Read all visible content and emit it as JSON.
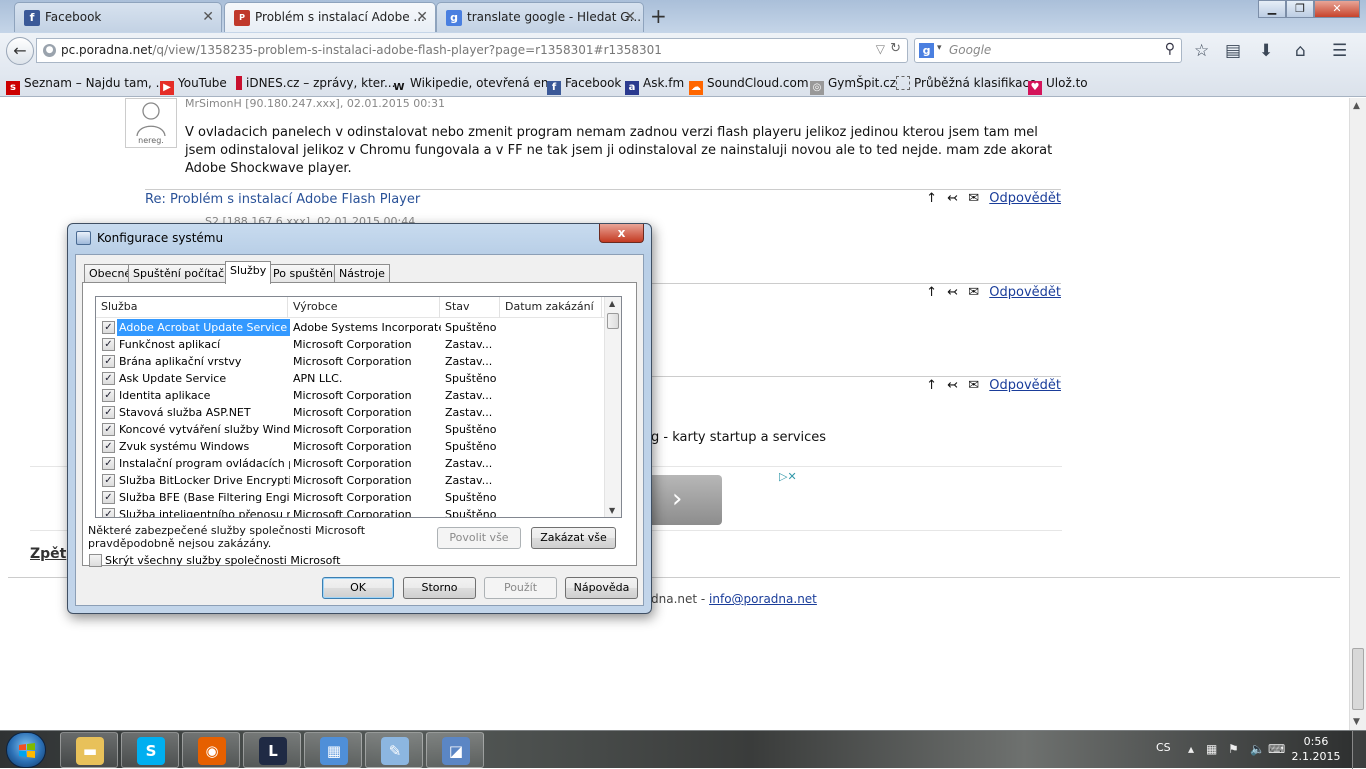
{
  "browser": {
    "tabs": [
      {
        "label": "Facebook",
        "icon": "facebook-icon",
        "active": false
      },
      {
        "label": "Problém s instalací Adobe ...",
        "icon": "poradna-icon",
        "active": true
      },
      {
        "label": "translate google - Hledat G...",
        "icon": "google-icon",
        "active": false
      }
    ],
    "new_tab": "+",
    "url_host": "pc.poradna.net",
    "url_path": "/q/view/1358235-problem-s-instalaci-adobe-flash-player?page=r1358301#r1358301",
    "search_placeholder": "Google",
    "bookmarks": [
      {
        "label": "Seznam – Najdu tam, ...",
        "icon": "seznam-icon",
        "color": "#cc0000"
      },
      {
        "label": "YouTube",
        "icon": "youtube-icon",
        "color": "#e52d27"
      },
      {
        "label": "iDNES.cz – zprávy, kter...",
        "icon": "idnes-icon",
        "color": "#c8102e"
      },
      {
        "label": "Wikipedie, otevřená en...",
        "icon": "wikipedia-icon",
        "color": "#444444"
      },
      {
        "label": "Facebook",
        "icon": "facebook-icon",
        "color": "#3b5998"
      },
      {
        "label": "Ask.fm",
        "icon": "askfm-icon",
        "color": "#2a3a8f"
      },
      {
        "label": "SoundCloud.com",
        "icon": "soundcloud-icon",
        "color": "#ff6600"
      },
      {
        "label": "GymŠpit.cz",
        "icon": "gymspit-icon",
        "color": "#999999"
      },
      {
        "label": "Průběžná klasifikace",
        "icon": "page-icon",
        "color": "#ffffff"
      },
      {
        "label": "Ulož.to",
        "icon": "ulozto-icon",
        "color": "#d4145a"
      }
    ]
  },
  "page": {
    "post1": {
      "avatar_label": "nereg.",
      "meta": "MrSimonH [90.180.247.xxx], 02.01.2015 00:31",
      "text": "V ovladacich panelech v odinstalovat nebo zmenit program nemam zadnou verzi flash playeru jelikoz jedinou kterou jsem tam mel jsem odinstaloval jelikoz v Chromu fungovala a v FF ne tak jsem ji odinstaloval ze nainstaluji novou ale to ted nejde. mam zde akorat Adobe Shockwave player."
    },
    "reply_title": "Re: Problém s instalací Adobe Flash Player",
    "reply_actions": {
      "up": "↑",
      "back": "↢",
      "mail": "✉",
      "reply": "Odpovědět"
    },
    "post2_meta": "S2 [188.167.6.xxx], 02.01.2015 00:44",
    "tail_text": "g - karty startup a services",
    "ad_next": "›",
    "ad_choices": "▷✕",
    "back_link": "Zpět",
    "footer_text": "dna.net - ",
    "footer_email": "info@poradna.net"
  },
  "dialog": {
    "title": "Konfigurace systému",
    "close": "x",
    "tabs": [
      "Obecné",
      "Spuštění počítače",
      "Služby",
      "Po spuštění",
      "Nástroje"
    ],
    "active_tab": "Služby",
    "columns": [
      "Služba",
      "Výrobce",
      "Stav",
      "Datum zakázání"
    ],
    "services": [
      {
        "name": "Adobe Acrobat Update Service",
        "vendor": "Adobe Systems Incorporated",
        "status": "Spuštěno",
        "checked": true
      },
      {
        "name": "Funkčnost aplikací",
        "vendor": "Microsoft Corporation",
        "status": "Zastav...",
        "checked": true
      },
      {
        "name": "Brána aplikační vrstvy",
        "vendor": "Microsoft Corporation",
        "status": "Zastav...",
        "checked": true
      },
      {
        "name": "Ask Update Service",
        "vendor": "APN LLC.",
        "status": "Spuštěno",
        "checked": true
      },
      {
        "name": "Identita aplikace",
        "vendor": "Microsoft Corporation",
        "status": "Zastav...",
        "checked": true
      },
      {
        "name": "Stavová služba ASP.NET",
        "vendor": "Microsoft Corporation",
        "status": "Zastav...",
        "checked": true
      },
      {
        "name": "Koncové vytváření služby Windo...",
        "vendor": "Microsoft Corporation",
        "status": "Spuštěno",
        "checked": true
      },
      {
        "name": "Zvuk systému Windows",
        "vendor": "Microsoft Corporation",
        "status": "Spuštěno",
        "checked": true
      },
      {
        "name": "Instalační program ovládacích pr...",
        "vendor": "Microsoft Corporation",
        "status": "Zastav...",
        "checked": true
      },
      {
        "name": "Služba BitLocker Drive Encryption",
        "vendor": "Microsoft Corporation",
        "status": "Zastav...",
        "checked": true
      },
      {
        "name": "Služba BFE (Base Filtering Engine)",
        "vendor": "Microsoft Corporation",
        "status": "Spuštěno",
        "checked": true
      },
      {
        "name": "Služba inteligentního přenosu na...",
        "vendor": "Microsoft Corporation",
        "status": "Spuštěno",
        "checked": true
      }
    ],
    "note": "Některé zabezpečené služby společnosti Microsoft pravděpodobně nejsou zakázány.",
    "enable_all": "Povolit vše",
    "disable_all": "Zakázat vše",
    "hide_ms": "Skrýt všechny služby společnosti Microsoft",
    "ok": "OK",
    "cancel": "Storno",
    "apply": "Použít",
    "help": "Nápověda"
  },
  "taskbar": {
    "apps": [
      {
        "name": "explorer",
        "icon": "folder-icon",
        "color": "#e8c15a"
      },
      {
        "name": "skype",
        "icon": "skype-icon",
        "color": "#00aff0"
      },
      {
        "name": "firefox",
        "icon": "firefox-icon",
        "color": "#e66000"
      },
      {
        "name": "league",
        "icon": "league-of-legends-icon",
        "color": "#1f2a44"
      },
      {
        "name": "control-panel",
        "icon": "control-panel-icon",
        "color": "#4f8fd8"
      },
      {
        "name": "paint",
        "icon": "paint-icon",
        "color": "#8cb6e0"
      },
      {
        "name": "msconfig",
        "icon": "system-config-icon",
        "color": "#5b86c4"
      }
    ],
    "lang": "CS",
    "time": "0:56",
    "date": "2.1.2015"
  }
}
